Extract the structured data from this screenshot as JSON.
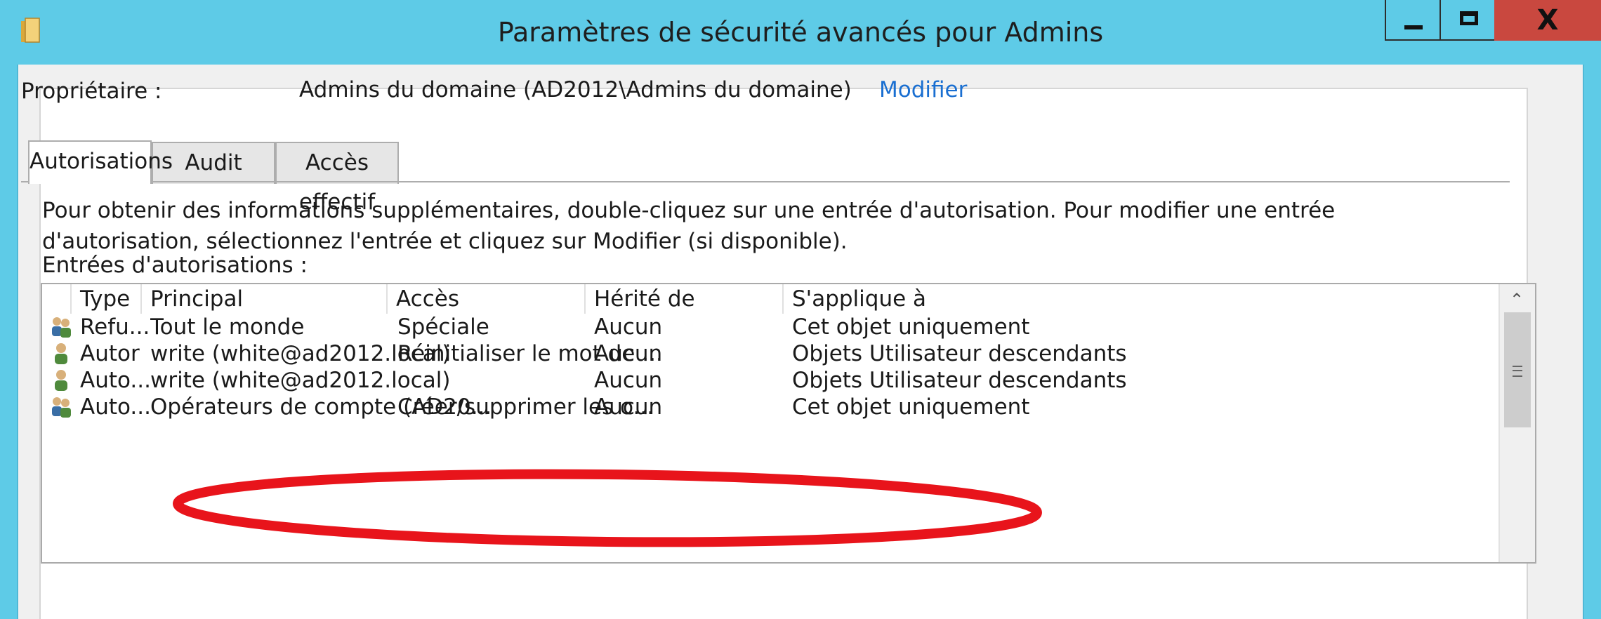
{
  "window": {
    "title": "Paramètres de sécurité avancés pour Admins",
    "close_glyph": "X"
  },
  "owner": {
    "label": "Propriétaire :",
    "value": "Admins du domaine (AD2012\\Admins du domaine)",
    "modify_link": "Modifier"
  },
  "tabs": [
    {
      "label": "Autorisations",
      "active": true
    },
    {
      "label": "Audit",
      "active": false
    },
    {
      "label": "Accès effectif",
      "active": false
    }
  ],
  "description": "Pour obtenir des informations supplémentaires, double-cliquez sur une entrée d'autorisation. Pour modifier une entrée d'autorisation, sélectionnez l'entrée et cliquez sur Modifier (si disponible).",
  "entries_label": "Entrées d'autorisations :",
  "columns": [
    "Type",
    "Principal",
    "Accès",
    "Hérité de",
    "S'applique à"
  ],
  "rows": [
    {
      "icon": "user-group-icon",
      "type": "Refu...",
      "principal": "Tout le monde",
      "access": "Spéciale",
      "inherited": "Aucun",
      "applies": "Cet objet uniquement"
    },
    {
      "icon": "user-icon",
      "type": "Autor",
      "principal": "write (white@ad2012.local)",
      "access": "Réinitialiser le mot de ...",
      "inherited": "Aucun",
      "applies": "Objets Utilisateur descendants"
    },
    {
      "icon": "user-icon",
      "type": "Auto...",
      "principal": "write (white@ad2012.local)",
      "access": "",
      "inherited": "Aucun",
      "applies": "Objets Utilisateur descendants"
    },
    {
      "icon": "user-group-icon",
      "type": "Auto...",
      "principal": "Opérateurs de compte (AD20...",
      "access": "Créer/supprimer les o...",
      "inherited": "Aucun",
      "applies": "Cet objet uniquement"
    }
  ],
  "colors": {
    "titlebar": "#5ecbe7",
    "close_button": "#c9483f",
    "link": "#1a6fd1",
    "annotation": "#e8141b"
  }
}
